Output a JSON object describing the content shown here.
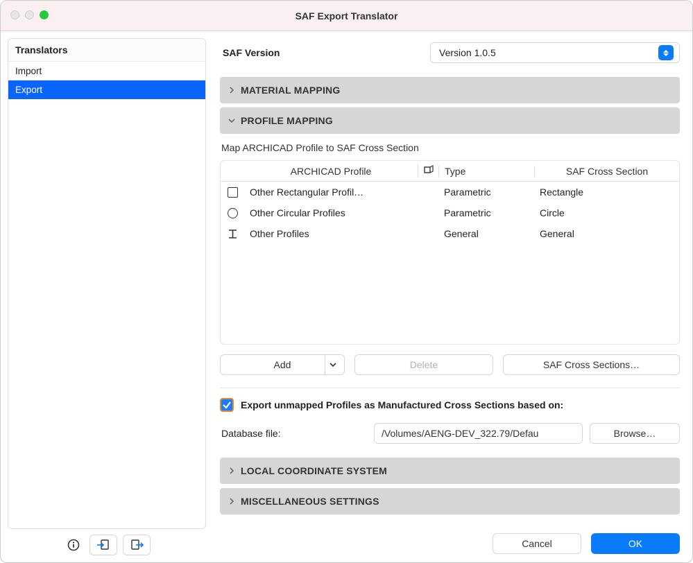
{
  "window": {
    "title": "SAF Export Translator"
  },
  "sidebar": {
    "header": "Translators",
    "items": [
      {
        "label": "Import",
        "selected": false
      },
      {
        "label": "Export",
        "selected": true
      }
    ]
  },
  "saf_version": {
    "label": "SAF Version",
    "value": "Version 1.0.5"
  },
  "sections": {
    "material": {
      "title": "MATERIAL MAPPING",
      "expanded": false
    },
    "profile": {
      "title": "PROFILE MAPPING",
      "expanded": true
    },
    "lcs": {
      "title": "LOCAL COORDINATE SYSTEM",
      "expanded": false
    },
    "misc": {
      "title": "MISCELLANEOUS SETTINGS",
      "expanded": false
    }
  },
  "profile_mapping": {
    "subtitle": "Map ARCHICAD Profile to SAF Cross Section",
    "columns": {
      "profile": "ARCHICAD Profile",
      "type": "Type",
      "saf": "SAF Cross Section"
    },
    "rows": [
      {
        "icon": "rect",
        "profile": "Other Rectangular Profil…",
        "type": "Parametric",
        "saf": "Rectangle"
      },
      {
        "icon": "circ",
        "profile": "Other Circular Profiles",
        "type": "Parametric",
        "saf": "Circle"
      },
      {
        "icon": "ibeam",
        "profile": "Other Profiles",
        "type": "General",
        "saf": "General"
      }
    ],
    "buttons": {
      "add": "Add",
      "delete": "Delete",
      "saf_cs": "SAF Cross Sections…"
    }
  },
  "export_unmapped": {
    "checked": true,
    "label": "Export unmapped Profiles as Manufactured Cross Sections based on:"
  },
  "database": {
    "label": "Database file:",
    "path": "/Volumes/AENG-DEV_322.79/Defau",
    "browse": "Browse…"
  },
  "footer": {
    "cancel": "Cancel",
    "ok": "OK"
  }
}
